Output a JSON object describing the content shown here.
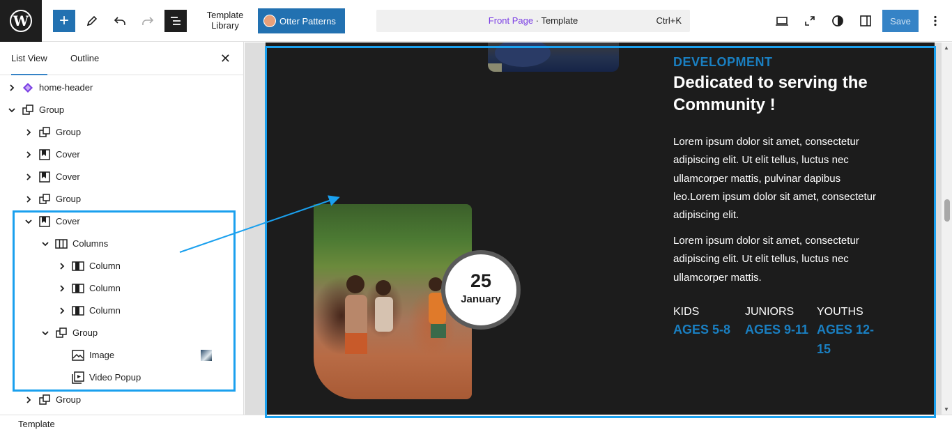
{
  "toolbar": {
    "template_library_label": "Template\nLibrary",
    "otter_patterns_label": "Otter Patterns",
    "command_center": {
      "page": "Front Page",
      "separator": " · ",
      "kind": "Template",
      "shortcut": "Ctrl+K"
    },
    "save_label": "Save"
  },
  "sidebar": {
    "tabs": [
      {
        "label": "List View",
        "active": true
      },
      {
        "label": "Outline",
        "active": false
      }
    ],
    "tree": [
      {
        "label": "home-header",
        "icon": "template-part-icon",
        "expanded": false
      },
      {
        "label": "Group",
        "icon": "group-icon",
        "expanded": true
      },
      {
        "label": "Group",
        "icon": "group-icon",
        "expanded": false
      },
      {
        "label": "Cover",
        "icon": "cover-icon",
        "expanded": false
      },
      {
        "label": "Cover",
        "icon": "cover-icon",
        "expanded": false
      },
      {
        "label": "Group",
        "icon": "group-icon",
        "expanded": false
      },
      {
        "label": "Cover",
        "icon": "cover-icon",
        "expanded": true
      },
      {
        "label": "Columns",
        "icon": "columns-icon",
        "expanded": true
      },
      {
        "label": "Column",
        "icon": "column-icon",
        "expanded": false
      },
      {
        "label": "Column",
        "icon": "column-icon",
        "expanded": false
      },
      {
        "label": "Column",
        "icon": "column-icon",
        "expanded": false
      },
      {
        "label": "Group",
        "icon": "group-icon",
        "expanded": true
      },
      {
        "label": "Image",
        "icon": "image-icon",
        "expanded": null
      },
      {
        "label": "Video Popup",
        "icon": "video-popup-icon",
        "expanded": null
      },
      {
        "label": "Group",
        "icon": "group-icon",
        "expanded": false
      }
    ]
  },
  "status_bar": {
    "label": "Template"
  },
  "canvas": {
    "eyebrow": "DEVELOPMENT",
    "headline": "Dedicated to serving the Community !",
    "paragraph_1": "Lorem ipsum dolor sit amet, consectetur adipiscing elit. Ut elit tellus, luctus nec ullamcorper mattis, pulvinar dapibus leo.Lorem ipsum dolor sit amet, consectetur adipiscing elit.",
    "paragraph_2": "Lorem ipsum dolor sit amet, consectetur adipiscing elit. Ut elit tellus, luctus nec ullamcorper mattis.",
    "date": {
      "day": "25",
      "month": "January"
    },
    "ages": [
      {
        "label": "KIDS",
        "value": "AGES 5-8"
      },
      {
        "label": "JUNIORS",
        "value": "AGES 9-11"
      },
      {
        "label": "YOUTHS",
        "value": "AGES 12-15"
      }
    ]
  },
  "colors": {
    "accent": "#1a7fc1",
    "highlight": "#1aa0ee",
    "wp_blue": "#2271b1",
    "dark_bg": "#1c1c1c"
  }
}
